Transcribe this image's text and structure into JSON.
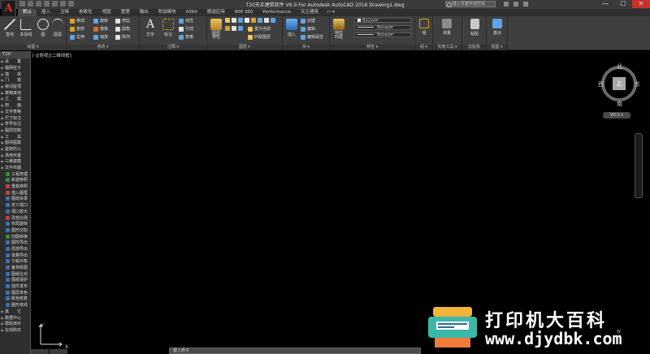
{
  "window": {
    "title": "T20天正建筑软件 V6.0 For Autodesk AutoCAD 2016     Drawing1.dwg",
    "search_placeholder": "键入关键字或短语",
    "minimize": "—",
    "maximize": "☐",
    "close": "✕"
  },
  "tabs": [
    "默认",
    "插入",
    "注释",
    "参数化",
    "视图",
    "管理",
    "输出",
    "附加模块",
    "A360",
    "精选应用",
    "BIM 360",
    "Performance",
    "天正建筑",
    "▭ ▾"
  ],
  "ribbon": {
    "draw": {
      "line": "直线",
      "polyline": "多段线",
      "circle": "圆",
      "arc": "圆弧",
      "label": "绘图 ▾"
    },
    "modify": {
      "move": "移动",
      "rotate": "旋转",
      "trim": "修剪",
      "copy": "复制",
      "mirror": "镜像",
      "fillet": "圆角",
      "stretch": "拉伸",
      "scale": "缩放",
      "array": "阵列",
      "label": "修改 ▾"
    },
    "annotation": {
      "text": "文字",
      "dimension": "标注",
      "linear": "线性",
      "leader": "引线",
      "table": "表格",
      "label": "注释 ▾"
    },
    "layers": {
      "layer_props": "图层\n特性",
      "make_current": "置为当前",
      "match_layer": "匹配图层",
      "label": "图层 ▾"
    },
    "block": {
      "insert": "插入",
      "create": "创建",
      "edit": "编辑",
      "edit_attrs": "编辑属性",
      "label": "块 ▾"
    },
    "properties": {
      "match": "特性\n匹配",
      "color": "ByLayer",
      "linetype": "ByLayer",
      "lineweight": "ByLayer",
      "label": "特性 ▾"
    },
    "groups": {
      "group": "组",
      "label": "组 ▾"
    },
    "utilities": {
      "measure": "测量",
      "label": "实用工具 ▾"
    },
    "clipboard": {
      "paste": "粘贴",
      "label": "剪贴板"
    },
    "view": {
      "base": "基点",
      "label": "视图 ▾"
    }
  },
  "palette": {
    "title": "T20",
    "items": [
      {
        "label": "设　　置",
        "arrow": true,
        "color": "#4a7bd0"
      },
      {
        "label": "轴网柱子",
        "arrow": true,
        "color": "#4a7bd0"
      },
      {
        "label": "墙　　体",
        "arrow": true,
        "color": "#4a7bd0"
      },
      {
        "label": "门　　窗",
        "arrow": true,
        "color": "#4a7bd0"
      },
      {
        "label": "房间屋顶",
        "arrow": true,
        "color": "#4a7bd0"
      },
      {
        "label": "楼梯其他",
        "arrow": true,
        "color": "#4a7bd0"
      },
      {
        "label": "立　　面",
        "arrow": true,
        "color": "#4a7bd0"
      },
      {
        "label": "剖　　面",
        "arrow": true,
        "color": "#4a7bd0"
      },
      {
        "label": "文字表格",
        "arrow": true,
        "color": "#4a7bd0"
      },
      {
        "label": "尺寸标注",
        "arrow": true,
        "color": "#4a7bd0"
      },
      {
        "label": "符号标注",
        "arrow": true,
        "color": "#4a7bd0"
      },
      {
        "label": "图层控制",
        "arrow": true,
        "color": "#4a7bd0"
      },
      {
        "label": "工　　具",
        "arrow": true,
        "color": "#4a7bd0"
      },
      {
        "label": "图块图案",
        "arrow": true,
        "color": "#4a7bd0"
      },
      {
        "label": "建筑防火",
        "arrow": true,
        "color": "#4a7bd0"
      },
      {
        "label": "场地布置",
        "arrow": true,
        "color": "#4a7bd0"
      },
      {
        "label": "三维建模",
        "arrow": true,
        "color": "#4a7bd0"
      },
      {
        "label": "文件布图",
        "arrow": true,
        "color": "#4a7bd0"
      },
      {
        "label": "工程管理",
        "arrow": false,
        "color": "#3a8a3a"
      },
      {
        "label": "新建参照",
        "arrow": false,
        "color": "#3a8a3a"
      },
      {
        "label": "重载参照",
        "arrow": false,
        "color": "#c04040"
      },
      {
        "label": "插入图框",
        "arrow": false,
        "color": "#c04040"
      },
      {
        "label": "图纸目录",
        "arrow": false,
        "color": "#3a70b0"
      },
      {
        "label": "定义视口",
        "arrow": false,
        "color": "#3a70b0"
      },
      {
        "label": "视口放大",
        "arrow": false,
        "color": "#3a70b0"
      },
      {
        "label": "改变比例",
        "arrow": false,
        "color": "#c04040"
      },
      {
        "label": "布局旋转",
        "arrow": false,
        "color": "#3a70b0"
      },
      {
        "label": "图形切割",
        "arrow": false,
        "color": "#3a70b0"
      },
      {
        "label": "旧图转换",
        "arrow": false,
        "color": "#3a8a3a"
      },
      {
        "label": "图形导出",
        "arrow": false,
        "color": "#3a70b0"
      },
      {
        "label": "局部导出",
        "arrow": false,
        "color": "#3a70b0"
      },
      {
        "label": "批量导出",
        "arrow": false,
        "color": "#3a70b0"
      },
      {
        "label": "分解对象",
        "arrow": false,
        "color": "#3a70b0"
      },
      {
        "label": "备档拆图",
        "arrow": false,
        "color": "#3a70b0"
      },
      {
        "label": "图纸比对",
        "arrow": false,
        "color": "#3a70b0"
      },
      {
        "label": "图纸保护",
        "arrow": false,
        "color": "#3a70b0"
      },
      {
        "label": "插件发布",
        "arrow": false,
        "color": "#3a70b0"
      },
      {
        "label": "图层单色",
        "arrow": false,
        "color": "#3a70b0"
      },
      {
        "label": "颜色恢复",
        "arrow": false,
        "color": "#3a70b0"
      },
      {
        "label": "图形变线",
        "arrow": false,
        "color": "#3a70b0"
      },
      {
        "label": "其　　它",
        "arrow": true,
        "color": "#4a7bd0"
      },
      {
        "label": "数据中心",
        "arrow": true,
        "color": "#4a7bd0"
      },
      {
        "label": "帮助演示",
        "arrow": true,
        "color": "#4a7bd0"
      },
      {
        "label": "在线购买",
        "arrow": true,
        "color": "#4a7bd0"
      }
    ]
  },
  "drawing": {
    "view_label": "[-][俯视][二维线框]",
    "ucs_y": "Y",
    "ucs_x": "X"
  },
  "viewcube": {
    "north": "北",
    "south": "南",
    "west": "西",
    "east": "东",
    "top": "上",
    "ucs": "WCS ▾"
  },
  "commandline": {
    "placeholder": "键入命令"
  },
  "watermark": {
    "text": "打印机大百科",
    "url": "www.djydbk.com",
    "corner": "双"
  }
}
